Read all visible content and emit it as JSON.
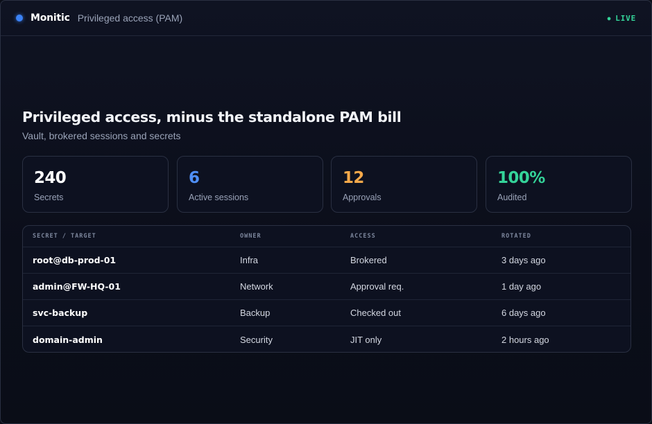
{
  "header": {
    "brand": "Monitic",
    "subtitle": "Privileged access (PAM)",
    "status": "LIVE",
    "status_dot": "●"
  },
  "hero": {
    "title": "Privileged access, minus the standalone PAM bill",
    "subtitle": "Vault, brokered sessions and secrets"
  },
  "stats": [
    {
      "value": "240",
      "label": "Secrets",
      "color": "#ffffff"
    },
    {
      "value": "6",
      "label": "Active sessions",
      "color": "#4f8ff7"
    },
    {
      "value": "12",
      "label": "Approvals",
      "color": "#f5a94a"
    },
    {
      "value": "100%",
      "label": "Audited",
      "color": "#34d399"
    }
  ],
  "table": {
    "columns": [
      "SECRET / TARGET",
      "OWNER",
      "ACCESS",
      "ROTATED"
    ],
    "rows": [
      {
        "target": "root@db-prod-01",
        "owner": "Infra",
        "access": "Brokered",
        "rotated": "3 days ago"
      },
      {
        "target": "admin@FW-HQ-01",
        "owner": "Network",
        "access": "Approval req.",
        "rotated": "1 day ago"
      },
      {
        "target": "svc-backup",
        "owner": "Backup",
        "access": "Checked out",
        "rotated": "6 days ago"
      },
      {
        "target": "domain-admin",
        "owner": "Security",
        "access": "JIT only",
        "rotated": "2 hours ago"
      }
    ]
  },
  "colors": {
    "accent": "#3b82f6",
    "live": "#34d399",
    "background": "#0b0e18"
  }
}
